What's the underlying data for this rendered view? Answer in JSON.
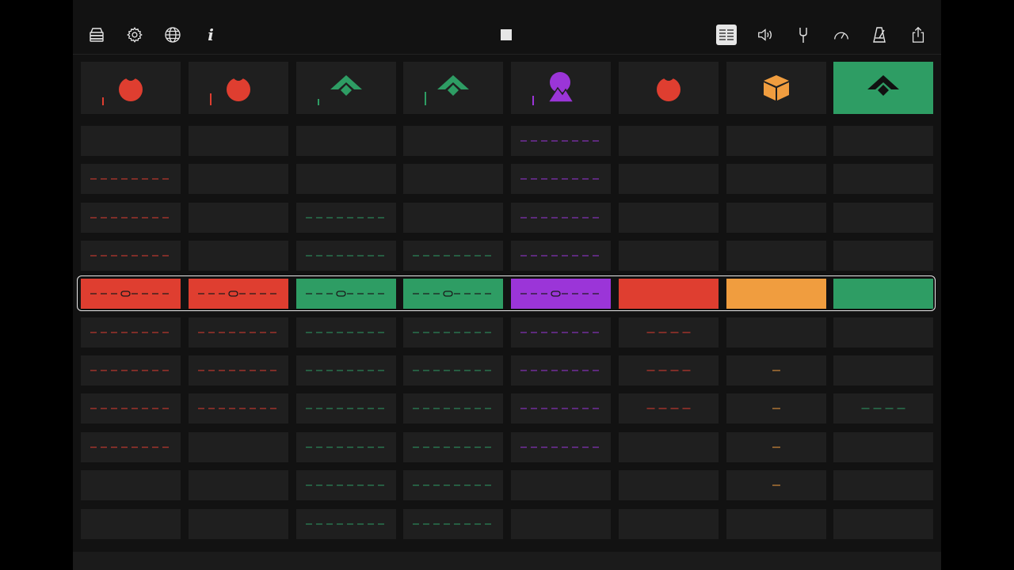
{
  "toolbar": {
    "left": [
      {
        "name": "library-icon"
      },
      {
        "name": "settings-gear-icon"
      },
      {
        "name": "globe-icon"
      },
      {
        "name": "info-icon",
        "glyph": "i"
      }
    ],
    "center": {
      "name": "stop-icon"
    },
    "right": [
      {
        "name": "mixer-list-icon",
        "active": true
      },
      {
        "name": "speaker-icon"
      },
      {
        "name": "tuning-fork-icon"
      },
      {
        "name": "tempo-gauge-icon"
      },
      {
        "name": "metronome-icon"
      },
      {
        "name": "share-icon"
      }
    ]
  },
  "colors": {
    "red": "#df3e30",
    "green": "#2e9d64",
    "purple": "#9b35d8",
    "orange": "#f09d3f",
    "cell": "#1f1f1f",
    "background": "#121212"
  },
  "tracks": [
    {
      "icon": "drum-icon",
      "color": "red",
      "level": 0.15,
      "selected": false
    },
    {
      "icon": "drum-icon",
      "color": "red",
      "level": 0.22,
      "selected": false
    },
    {
      "icon": "synth-chevron-icon",
      "color": "green",
      "level": 0.12,
      "selected": false
    },
    {
      "icon": "synth-chevron-icon",
      "color": "green",
      "level": 0.25,
      "selected": false
    },
    {
      "icon": "sampler-mountain-icon",
      "color": "purple",
      "level": 0.18,
      "selected": false
    },
    {
      "icon": "drum-icon",
      "color": "red",
      "level": 0,
      "selected": false
    },
    {
      "icon": "cube-icon",
      "color": "orange",
      "level": 0,
      "selected": false
    },
    {
      "icon": "synth-chevron-icon",
      "color": "green",
      "level": 0,
      "selected": true
    }
  ],
  "active_scene_row": 4,
  "clips": [
    [
      0,
      0,
      0,
      0,
      8,
      0,
      0,
      0
    ],
    [
      8,
      0,
      0,
      0,
      8,
      0,
      0,
      0
    ],
    [
      8,
      0,
      8,
      0,
      8,
      0,
      0,
      0
    ],
    [
      8,
      0,
      8,
      8,
      8,
      0,
      0,
      0
    ],
    [
      8,
      8,
      8,
      8,
      8,
      0,
      0,
      0
    ],
    [
      8,
      8,
      8,
      8,
      8,
      4,
      0,
      0
    ],
    [
      8,
      8,
      8,
      8,
      8,
      4,
      1,
      0
    ],
    [
      8,
      8,
      8,
      8,
      8,
      4,
      1,
      4
    ],
    [
      8,
      0,
      8,
      8,
      8,
      0,
      1,
      0
    ],
    [
      0,
      0,
      8,
      8,
      0,
      0,
      1,
      0
    ],
    [
      0,
      0,
      8,
      8,
      0,
      0,
      0,
      0
    ]
  ]
}
